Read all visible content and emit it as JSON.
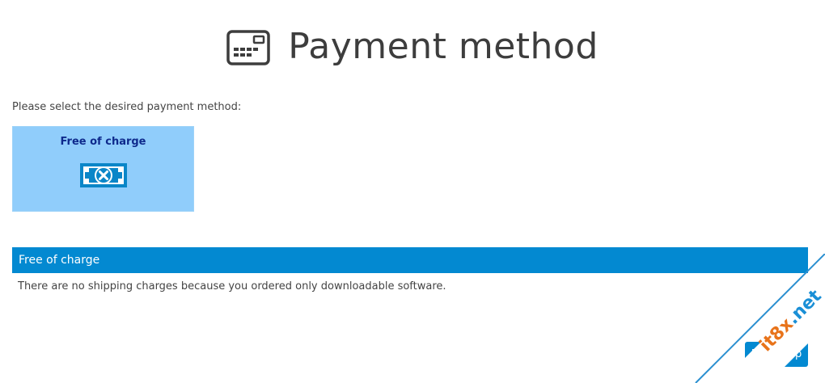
{
  "header": {
    "title": "Payment method",
    "icon": "credit-card-icon"
  },
  "instruction": "Please select the desired payment method:",
  "payment_options": [
    {
      "label": "Free of charge",
      "icon": "money-bill-x-icon",
      "selected": true
    }
  ],
  "info_panel": {
    "title": "Free of charge",
    "text": "There are no shipping charges because you ordered only downloadable software."
  },
  "next_button": {
    "label": "Next step"
  },
  "watermark": {
    "text_prefix": "it8x",
    "text_suffix": ".net",
    "prefix_color": "#e8731a",
    "suffix_color": "#1a8fd6"
  },
  "colors": {
    "accent": "#0389d1",
    "option_background": "#90cdfb",
    "option_label": "#0e2a8c",
    "title_text": "#3d3d3d"
  }
}
